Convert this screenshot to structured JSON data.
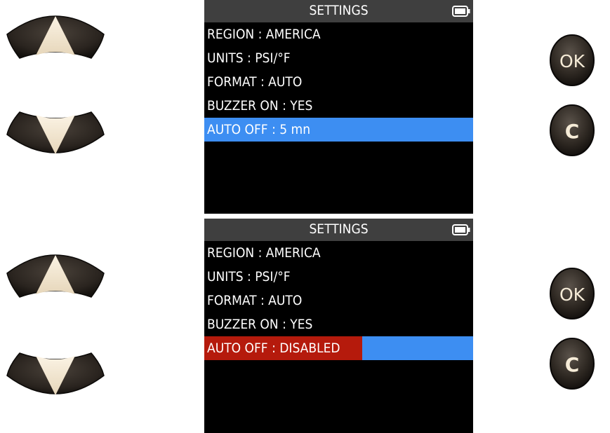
{
  "controls": {
    "up_button": {
      "icon": "up-arrow-icon"
    },
    "down_button": {
      "icon": "down-arrow-icon"
    },
    "ok_label": "OK",
    "cancel_label": "C"
  },
  "screens": [
    {
      "title": "SETTINGS",
      "battery_icon": "battery-icon",
      "items": [
        {
          "label": "REGION : AMERICA"
        },
        {
          "label": "UNITS  :  PSI/°F"
        },
        {
          "label": "FORMAT  :  AUTO"
        },
        {
          "label": "BUZZER ON  : YES"
        },
        {
          "label": "AUTO OFF  :  5 mn",
          "state": "selected"
        }
      ]
    },
    {
      "title": "SETTINGS",
      "battery_icon": "battery-icon",
      "items": [
        {
          "label": "REGION : AMERICA"
        },
        {
          "label": "UNITS  :  PSI/°F"
        },
        {
          "label": "FORMAT  :  AUTO"
        },
        {
          "label": "BUZZER ON  : YES"
        },
        {
          "label": "AUTO OFF  :  DISABLED",
          "state": "editing"
        }
      ]
    }
  ],
  "colors": {
    "selection_blue": "#3d8ef2",
    "edit_red": "#b51a0c",
    "title_bar": "#3f3f3f",
    "button_dark": "#2b2620",
    "arrow_cream": "#f3e6d0"
  }
}
